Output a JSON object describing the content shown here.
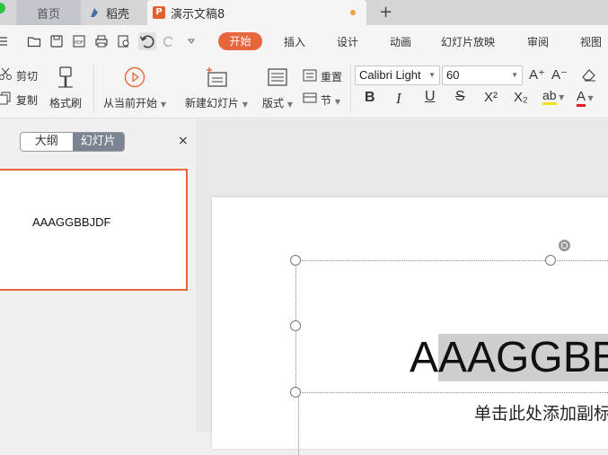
{
  "tabs": {
    "home": "首页",
    "daoke": "稻壳",
    "doc": "演示文稿8",
    "new_tab": "+"
  },
  "menu": {
    "start": "开始",
    "insert": "插入",
    "design": "设计",
    "animation": "动画",
    "slideshow": "幻灯片放映",
    "review": "审阅",
    "view": "视图"
  },
  "ribbon": {
    "cut": "剪切",
    "copy": "复制",
    "format_painter": "格式刷",
    "from_current": "从当前开始",
    "new_slide": "新建幻灯片",
    "layout": "版式",
    "reset": "重置",
    "section": "节",
    "font_name": "Calibri Light",
    "font_size": "60",
    "bold": "B",
    "italic": "I",
    "underline": "U",
    "strike": "S",
    "superscript": "X²",
    "subscript": "X₂",
    "font_color_glyph": "A",
    "highlight_glyph": "ab",
    "grow_font": "A⁺",
    "shrink_font": "A⁻"
  },
  "panel": {
    "outline_tab": "大纲",
    "slides_tab": "幻灯片",
    "close": "×",
    "thumb_text": "AAAGGBBJDF"
  },
  "slide": {
    "title_plain": "A",
    "title_selected": "AAGGBB",
    "subtitle_placeholder": "单击此处添加副标"
  },
  "colors": {
    "accent": "#e8663d",
    "tab_active_bg": "#f5f5f5",
    "seg_active": "#7b8493"
  }
}
